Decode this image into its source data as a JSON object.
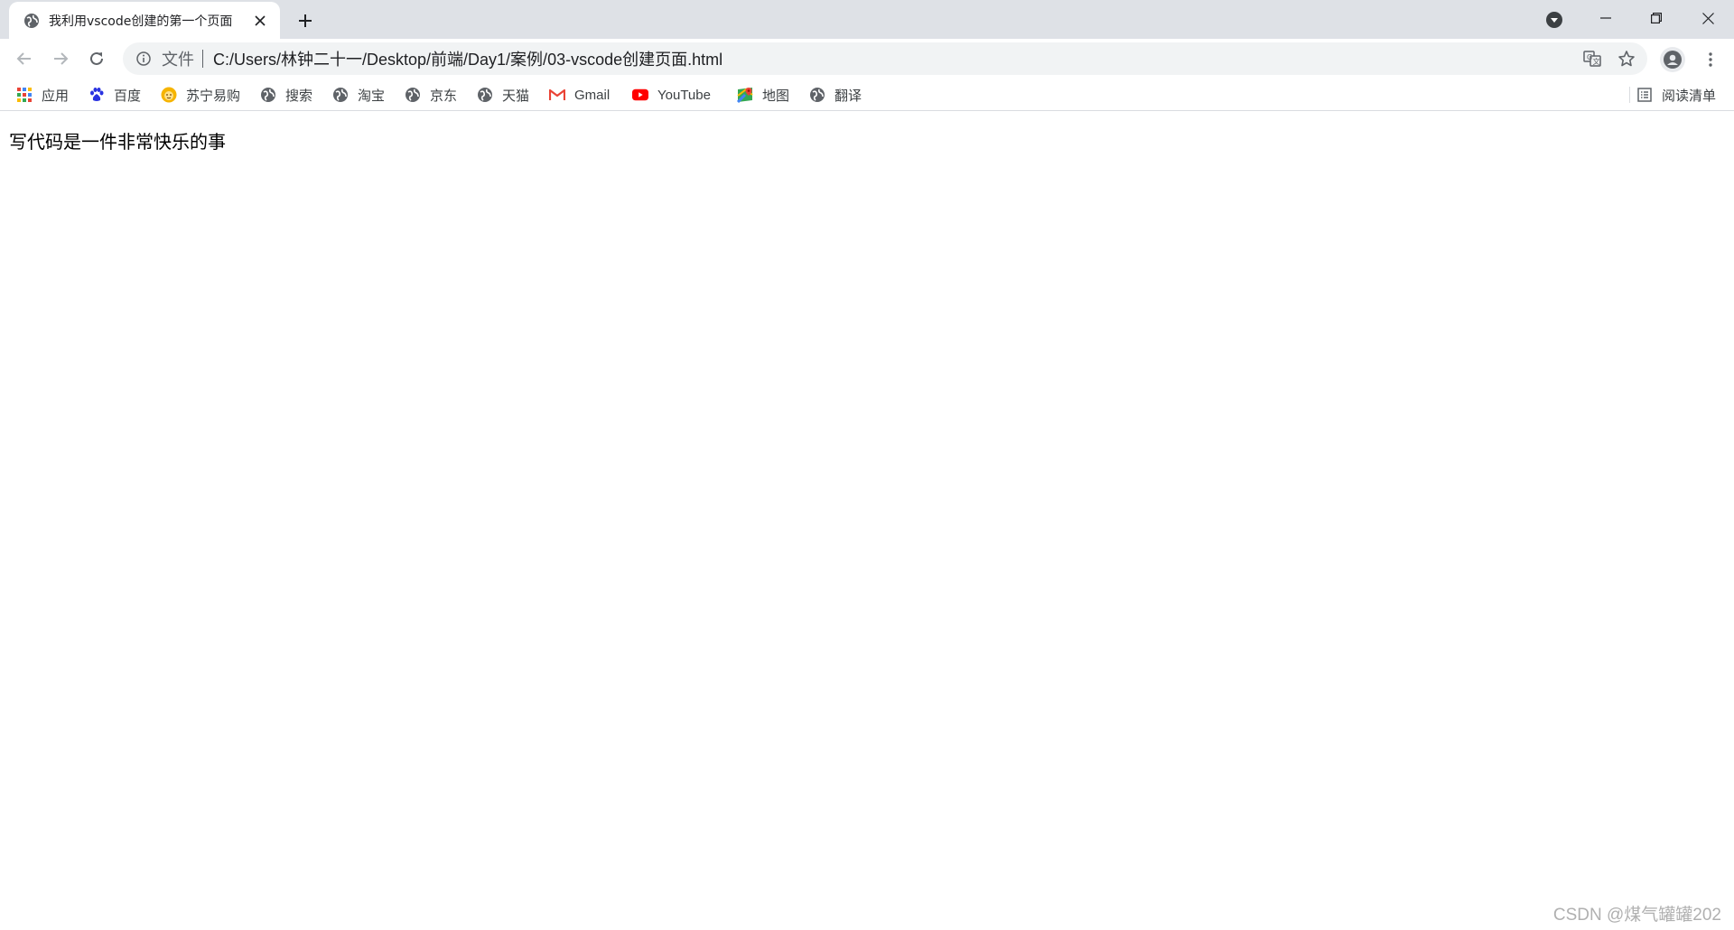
{
  "tab": {
    "title": "我利用vscode创建的第一个页面"
  },
  "omnibox": {
    "chip": "文件",
    "url": "C:/Users/林钟二十一/Desktop/前端/Day1/案例/03-vscode创建页面.html"
  },
  "bookmarks": [
    {
      "label": "应用",
      "icon": "apps-grid-icon"
    },
    {
      "label": "百度",
      "icon": "baidu-paw-icon"
    },
    {
      "label": "苏宁易购",
      "icon": "suning-lion-icon"
    },
    {
      "label": "搜索",
      "icon": "globe-icon"
    },
    {
      "label": "淘宝",
      "icon": "globe-icon"
    },
    {
      "label": "京东",
      "icon": "globe-icon"
    },
    {
      "label": "天猫",
      "icon": "globe-icon"
    },
    {
      "label": "Gmail",
      "icon": "gmail-icon"
    },
    {
      "label": "YouTube",
      "icon": "youtube-icon"
    },
    {
      "label": "地图",
      "icon": "maps-pin-icon"
    },
    {
      "label": "翻译",
      "icon": "globe-icon"
    }
  ],
  "reading_list": {
    "label": "阅读清单",
    "icon": "reading-list-icon"
  },
  "page": {
    "body_text": "写代码是一件非常快乐的事"
  },
  "watermark": "CSDN @煤气罐罐202",
  "colors": {
    "tabstrip": "#dee1e6",
    "omnibox": "#f1f3f4",
    "icon": "#5f6368"
  }
}
